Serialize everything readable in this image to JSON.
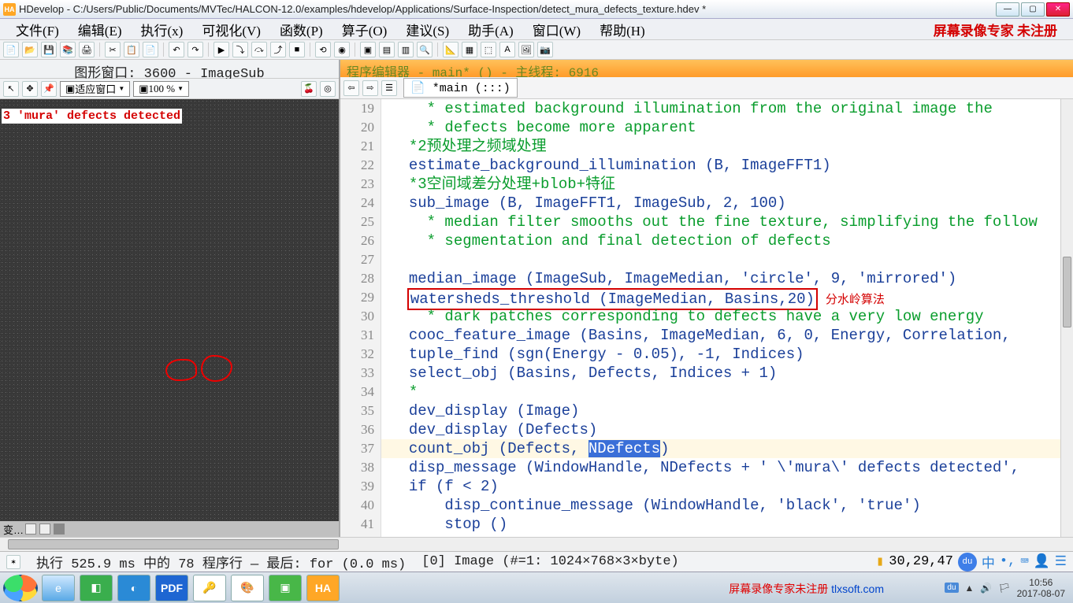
{
  "title": "HDevelop - C:/Users/Public/Documents/MVTec/HALCON-12.0/examples/hdevelop/Applications/Surface-Inspection/detect_mura_defects_texture.hdev *",
  "menu": {
    "file": "文件(F)",
    "edit": "编辑(E)",
    "exec": "执行(x)",
    "vis": "可视化(V)",
    "func": "函数(P)",
    "op": "算子(O)",
    "sugg": "建议(S)",
    "assist": "助手(A)",
    "window": "窗口(W)",
    "help": "帮助(H)",
    "reg": "屏幕录像专家 未注册"
  },
  "gfx": {
    "title": "图形窗口: 3600 - ImageSub",
    "fit": "适应窗口",
    "zoom": "100 %",
    "overlay": "3 'mura' defects detected"
  },
  "prog": {
    "head": "程序编辑器 - main* () - 主线程: 6916",
    "crumb": "*main (:::)"
  },
  "annotation": "分水岭算法",
  "varbar": "变…",
  "code_start_line": 19,
  "code": [
    {
      "cls": "cm",
      "t": "  * estimated background illumination from the original image the"
    },
    {
      "cls": "cm",
      "t": "  * defects become more apparent"
    },
    {
      "cls": "cm",
      "t": "*2预处理之频域处理"
    },
    {
      "cls": "fn",
      "t": "estimate_background_illumination (B, ImageFFT1)"
    },
    {
      "cls": "cm",
      "t": "*3空间域差分处理+blob+特征"
    },
    {
      "cls": "fn",
      "t": "sub_image (B, ImageFFT1, ImageSub, 2, 100)"
    },
    {
      "cls": "cm",
      "t": "  * median filter smooths out the fine texture, simplifying the follow"
    },
    {
      "cls": "cm",
      "t": "  * segmentation and final detection of defects"
    },
    {
      "cls": "pl",
      "t": ""
    },
    {
      "cls": "fn",
      "t": "median_image (ImageSub, ImageMedian, 'circle', 9, 'mirrored')"
    },
    {
      "cls": "fn",
      "t": "watersheds_threshold (ImageMedian, Basins,20)",
      "box": true,
      "anno": true
    },
    {
      "cls": "cm",
      "t": "  * dark patches corresponding to defects have a very low energy"
    },
    {
      "cls": "fn",
      "t": "cooc_feature_image (Basins, ImageMedian, 6, 0, Energy, Correlation,"
    },
    {
      "cls": "fn",
      "t": "tuple_find (sgn(Energy - 0.05), -1, Indices)"
    },
    {
      "cls": "fn",
      "t": "select_obj (Basins, Defects, Indices + 1)"
    },
    {
      "cls": "cm",
      "t": "*"
    },
    {
      "cls": "fn",
      "t": "dev_display (Image)"
    },
    {
      "cls": "fn",
      "t": "dev_display (Defects)"
    },
    {
      "cls": "fn",
      "t": "count_obj (Defects, ",
      "hi": true,
      "sel": "NDefects",
      "tail": ")"
    },
    {
      "cls": "fn",
      "t": "disp_message (WindowHandle, NDefects + ' \\'mura\\' defects detected',"
    },
    {
      "cls": "kw",
      "t": "if (f < 2)"
    },
    {
      "cls": "fn",
      "t": "    disp_continue_message (WindowHandle, 'black', 'true')"
    },
    {
      "cls": "kw",
      "t": "    stop ()"
    }
  ],
  "status": {
    "exec": "执行 525.9 ms 中的 78 程序行 — 最后: for (0.0 ms)",
    "img": "[0] Image (#=1: 1024×768×3×byte)",
    "coord": "30,29,47",
    "cn": "中"
  },
  "tray": {
    "time": "10:56",
    "date": "2017-08-07"
  },
  "wm": {
    "r": "屏幕录像专家未注册 ",
    "l": "tlxsoft.com"
  }
}
